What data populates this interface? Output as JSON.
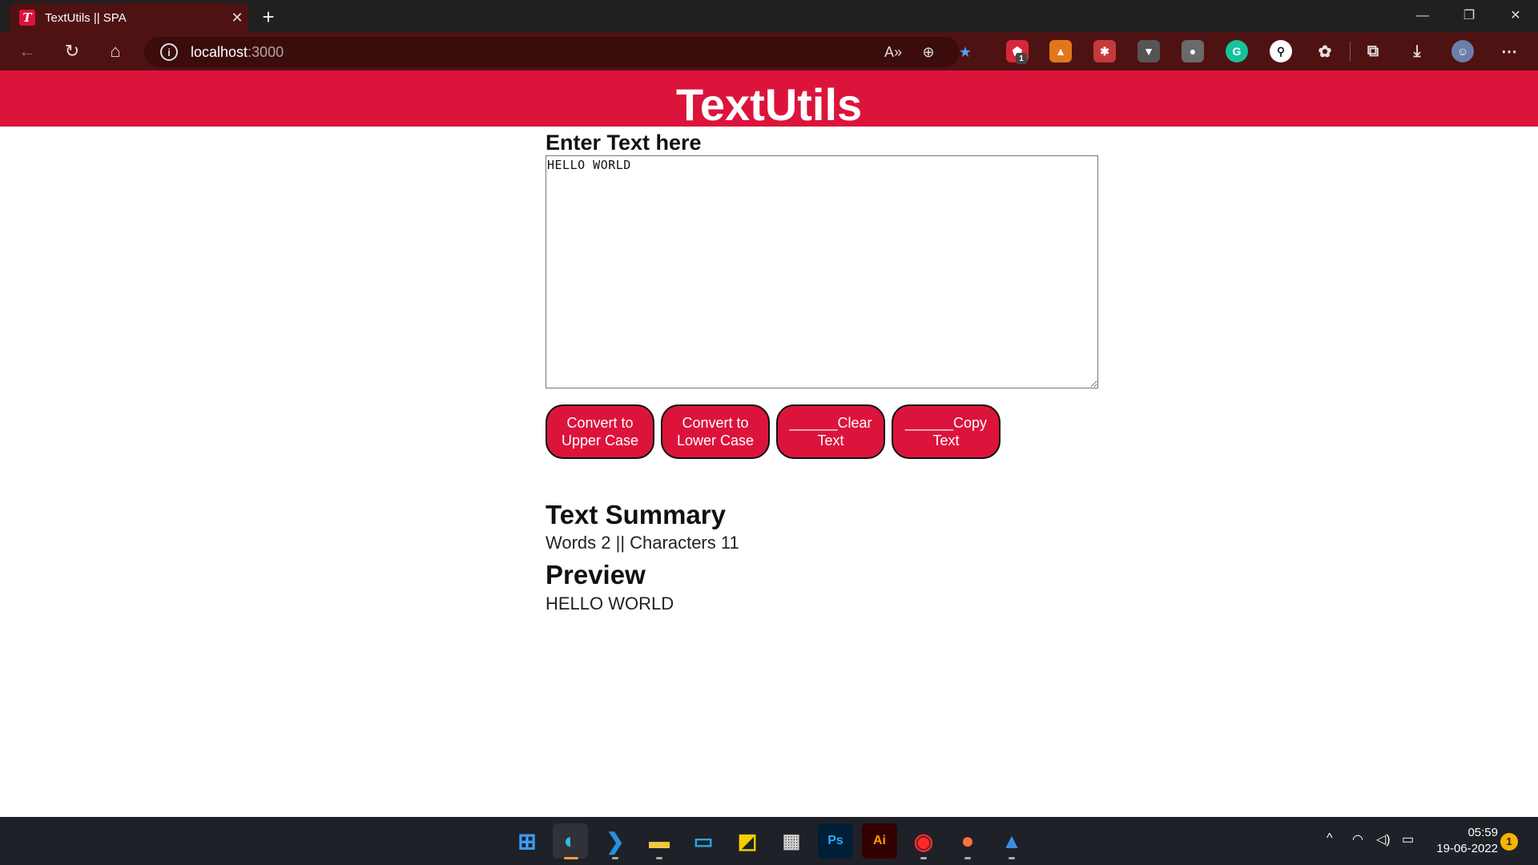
{
  "browser": {
    "tab_title": "TextUtils || SPA",
    "tab_favicon": "T",
    "tab_close": "✕",
    "new_tab": "+",
    "address_host": "localhost",
    "address_port": ":3000",
    "info_icon": "i"
  },
  "app": {
    "brand": "TextUtils",
    "accent_color": "#dc143c",
    "form_label": "Enter Text here",
    "textarea_value": "HELLO WORLD",
    "buttons": {
      "upper": "Convert to Upper Case",
      "lower": "Convert to Lower Case",
      "clear": "______Clear Text",
      "copy": "______Copy Text"
    },
    "summary_title": "Text Summary",
    "summary_text": "Words 2 || Characters 11",
    "preview_title": "Preview",
    "preview_text": "HELLO WORLD"
  },
  "taskbar": {
    "time": "05:59",
    "date": "19-06-2022",
    "notifications": "1",
    "extension_badge": "1"
  },
  "icons": [
    "back-arrow-icon",
    "refresh-icon",
    "home-icon",
    "read-aloud-icon",
    "zoom-icon",
    "favorite-star-icon",
    "extensions-icon",
    "collections-icon",
    "download-icon",
    "profile-avatar",
    "more-menu-icon",
    "windows-start-icon",
    "edge-icon",
    "vscode-icon",
    "file-explorer-icon",
    "photoshop-icon",
    "illustrator-icon",
    "firefox-icon",
    "wifi-icon",
    "volume-icon",
    "battery-icon"
  ]
}
